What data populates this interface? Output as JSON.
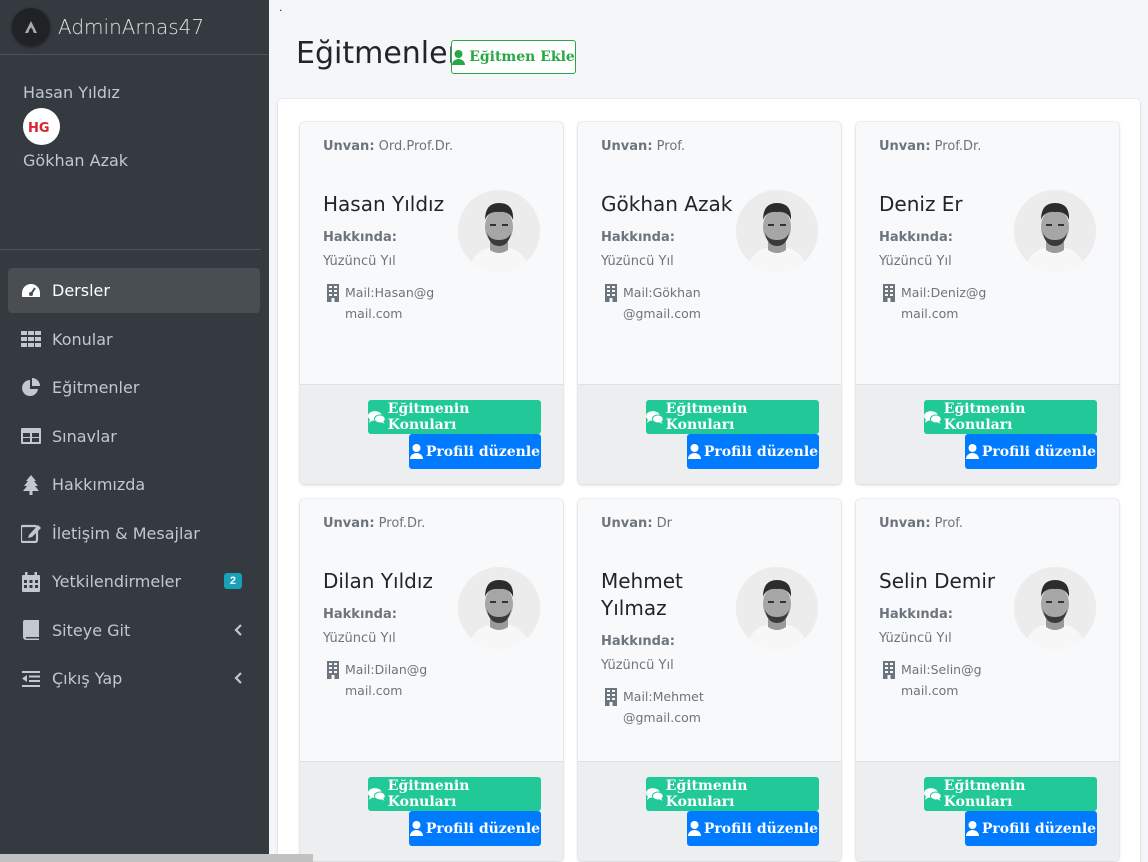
{
  "brand": {
    "name": "AdminArnas47",
    "icon": "brand-logo-icon"
  },
  "user_panel": {
    "user1": "Hasan Yıldız",
    "avatar_text": "HG",
    "user2": "Gökhan Azak"
  },
  "nav": [
    {
      "label": "Dersler",
      "icon": "tachometer-icon",
      "active": true
    },
    {
      "label": "Konular",
      "icon": "grid-icon"
    },
    {
      "label": "Eğitmenler",
      "icon": "pie-chart-icon"
    },
    {
      "label": "Sınavlar",
      "icon": "table-icon"
    },
    {
      "label": "Hakkımızda",
      "icon": "tree-icon"
    },
    {
      "label": "İletişim & Mesajlar",
      "icon": "edit-icon"
    },
    {
      "label": "Yetkilendirmeler",
      "icon": "calendar-icon",
      "badge": "2"
    },
    {
      "label": "Siteye Git",
      "icon": "book-icon",
      "chevron": true
    },
    {
      "label": "Çıkış Yap",
      "icon": "outdent-icon",
      "chevron": true
    }
  ],
  "page": {
    "dot": ".",
    "title": "Eğitmenler",
    "add_button": "Eğitmen Ekle"
  },
  "labels": {
    "unvan": "Unvan:",
    "hakkinda": "Hakkında:",
    "topics_btn": "Eğitmenin Konuları",
    "profile_btn": "Profili düzenle"
  },
  "instructors": [
    {
      "unvan": "Ord.Prof.Dr.",
      "name": "Hasan Yıldız",
      "about": "Yüzüncü Yıl",
      "mail": "Mail:Hasan@gmail.com"
    },
    {
      "unvan": "Prof.",
      "name": "Gökhan Azak",
      "about": "Yüzüncü Yıl",
      "mail": "Mail:Gökhan@gmail.com"
    },
    {
      "unvan": "Prof.Dr.",
      "name": "Deniz Er",
      "about": "Yüzüncü Yıl",
      "mail": "Mail:Deniz@gmail.com"
    },
    {
      "unvan": "Prof.Dr.",
      "name": "Dilan Yıldız",
      "about": "Yüzüncü Yıl",
      "mail": "Mail:Dilan@gmail.com"
    },
    {
      "unvan": "Dr",
      "name": "Mehmet Yılmaz",
      "about": "Yüzüncü Yıl",
      "mail": "Mail:Mehmet@gmail.com"
    },
    {
      "unvan": "Prof.",
      "name": "Selin Demir",
      "about": "Yüzüncü Yıl",
      "mail": "Mail:Selin@gmail.com"
    }
  ],
  "colors": {
    "sidebar": "#343a40",
    "success": "#28a745",
    "teal": "#20c997",
    "primary": "#007bff",
    "badge": "#17a2b8"
  }
}
